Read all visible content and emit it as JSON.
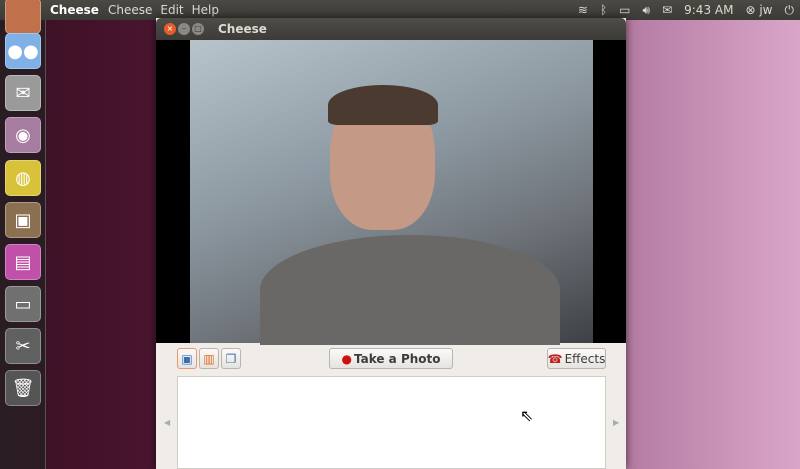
{
  "panel": {
    "app_name": "Cheese",
    "menus": [
      "Cheese",
      "Edit",
      "Help"
    ],
    "time": "9:43 AM",
    "user": "jw"
  },
  "window": {
    "title": "Cheese",
    "take_photo": "Take a Photo",
    "effects": "Effects"
  }
}
